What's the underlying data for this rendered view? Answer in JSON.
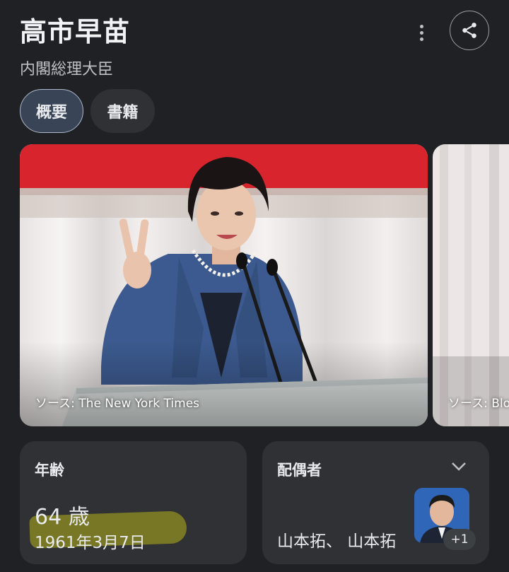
{
  "header": {
    "title": "高市早苗",
    "subtitle": "内閣総理大臣"
  },
  "actions": {
    "more_icon": "more-vert-icon",
    "share_icon": "share-icon"
  },
  "tabs": [
    {
      "label": "概要",
      "selected": true
    },
    {
      "label": "書籍",
      "selected": false
    }
  ],
  "images": [
    {
      "source": "ソース: The New York Times"
    },
    {
      "source": "ソース: Blo"
    }
  ],
  "cards": {
    "age": {
      "label": "年齢",
      "value": "64 歳",
      "birth_date": "1961年3月7日"
    },
    "spouse": {
      "label": "配偶者",
      "names": "山本拓、 山本拓",
      "more_count": "+1"
    }
  },
  "colors": {
    "background": "#202124",
    "card": "#303134",
    "selected_tab": "#394457",
    "highlight": "#7e7d24"
  }
}
